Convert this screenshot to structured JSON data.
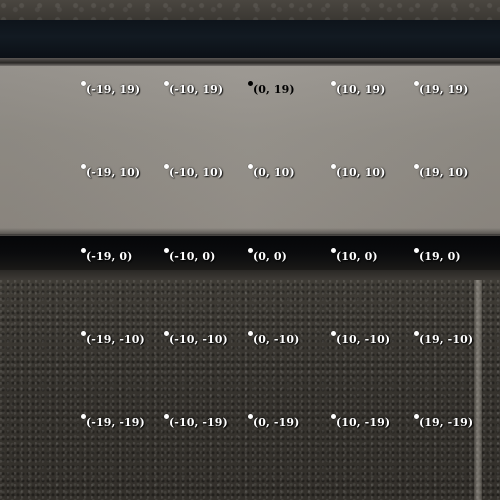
{
  "grid": {
    "colors": {
      "default_marker": "#ffffff",
      "highlight_marker": "#000000"
    },
    "rows": [
      {
        "points": [
          {
            "label": "(-19, 19)",
            "highlight": false
          },
          {
            "label": "(-10, 19)",
            "highlight": false
          },
          {
            "label": "(0, 19)",
            "highlight": true
          },
          {
            "label": "(10, 19)",
            "highlight": false
          },
          {
            "label": "(19, 19)",
            "highlight": false
          }
        ]
      },
      {
        "points": [
          {
            "label": "(-19, 10)",
            "highlight": false
          },
          {
            "label": "(-10, 10)",
            "highlight": false
          },
          {
            "label": "(0, 10)",
            "highlight": false
          },
          {
            "label": "(10, 10)",
            "highlight": false
          },
          {
            "label": "(19, 10)",
            "highlight": false
          }
        ]
      },
      {
        "points": [
          {
            "label": "(-19, 0)",
            "highlight": false
          },
          {
            "label": "(-10, 0)",
            "highlight": false
          },
          {
            "label": "(0, 0)",
            "highlight": false
          },
          {
            "label": "(10, 0)",
            "highlight": false
          },
          {
            "label": "(19, 0)",
            "highlight": false
          }
        ]
      },
      {
        "points": [
          {
            "label": "(-19, -10)",
            "highlight": false
          },
          {
            "label": "(-10, -10)",
            "highlight": false
          },
          {
            "label": "(0, -10)",
            "highlight": false
          },
          {
            "label": "(10, -10)",
            "highlight": false
          },
          {
            "label": "(19, -10)",
            "highlight": false
          }
        ]
      },
      {
        "points": [
          {
            "label": "(-19, -19)",
            "highlight": false
          },
          {
            "label": "(-10, -19)",
            "highlight": false
          },
          {
            "label": "(0, -19)",
            "highlight": false
          },
          {
            "label": "(10, -19)",
            "highlight": false
          },
          {
            "label": "(19, -19)",
            "highlight": false
          }
        ]
      }
    ]
  }
}
